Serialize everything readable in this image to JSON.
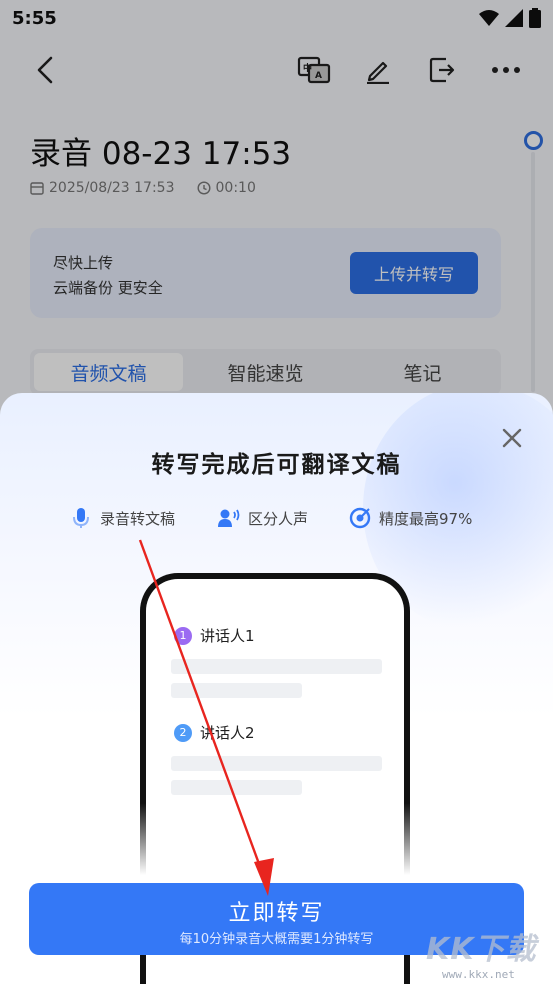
{
  "status_bar": {
    "time": "5:55"
  },
  "recording": {
    "title": "录音 08-23 17:53",
    "date": "2025/08/23 17:53",
    "duration": "00:10"
  },
  "upload_card": {
    "line1": "尽快上传",
    "line2": "云端备份 更安全",
    "button_label": "上传并转写"
  },
  "tabs": [
    {
      "label": "音频文稿",
      "active": true
    },
    {
      "label": "智能速览",
      "active": false
    },
    {
      "label": "笔记",
      "active": false
    }
  ],
  "sheet": {
    "title": "转写完成后可翻译文稿",
    "features": [
      {
        "icon": "microphone-icon",
        "label": "录音转文稿"
      },
      {
        "icon": "speaker-person-icon",
        "label": "区分人声"
      },
      {
        "icon": "target-icon",
        "label": "精度最高97%"
      }
    ],
    "phone": {
      "speakers": [
        {
          "num": "1",
          "label": "讲话人1",
          "color": "#9b6bf2"
        },
        {
          "num": "2",
          "label": "讲话人2",
          "color": "#4f9bf7"
        }
      ]
    },
    "cta": {
      "label": "立即转写",
      "sublabel": "每10分钟录音大概需要1分钟转写"
    }
  },
  "watermark": {
    "logo": "KK下载",
    "url": "www.kkx.net"
  },
  "colors": {
    "accent": "#2d6fe6",
    "cta": "#3478f6",
    "annotation_arrow": "#e8251f"
  }
}
